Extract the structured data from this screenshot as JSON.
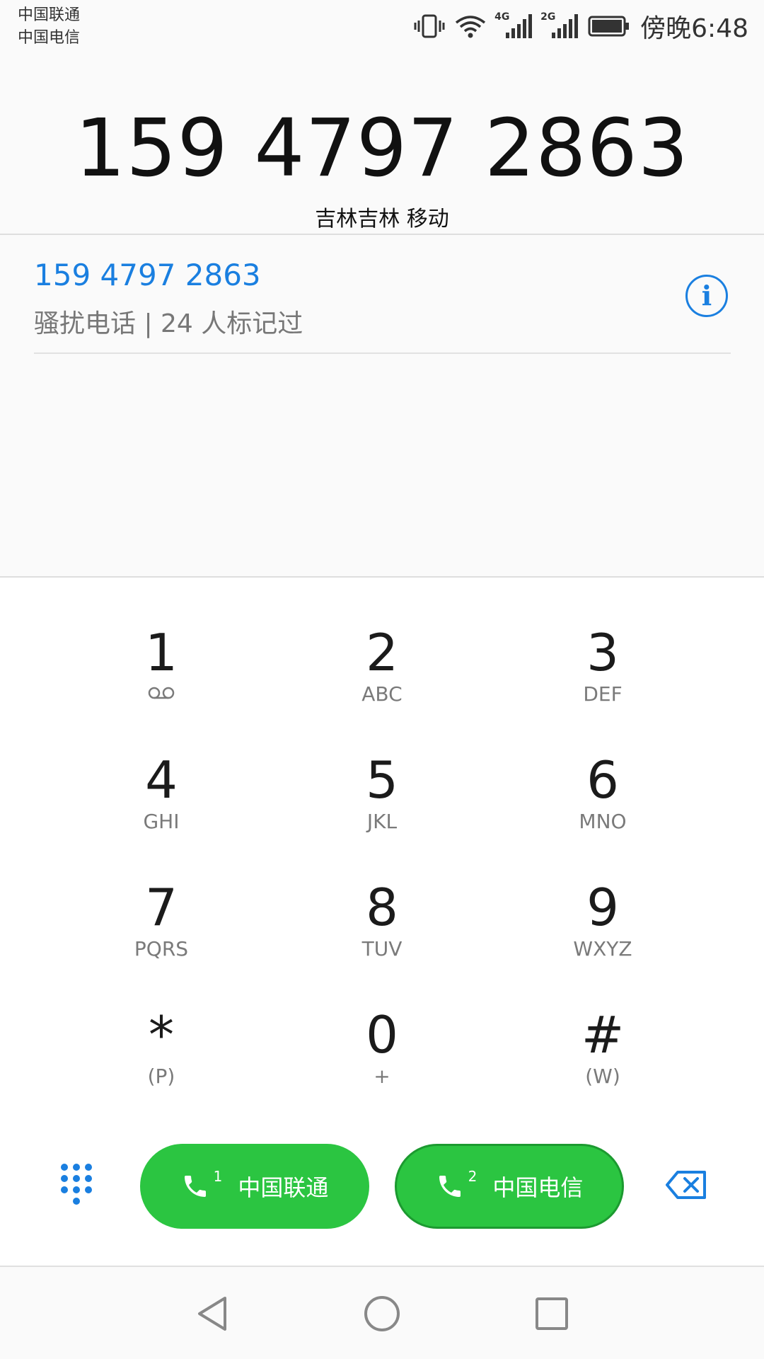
{
  "status_bar": {
    "carrier_1": "中国联通",
    "carrier_2": "中国电信",
    "net_1": "4G",
    "net_2": "2G",
    "time": "傍晚6:48"
  },
  "dialer": {
    "number": "159 4797 2863",
    "location": "吉林吉林 移动"
  },
  "suggestion": {
    "number": "159 4797 2863",
    "tag": "骚扰电话 | 24 人标记过"
  },
  "keypad": [
    {
      "digit": "1",
      "letters": ""
    },
    {
      "digit": "2",
      "letters": "ABC"
    },
    {
      "digit": "3",
      "letters": "DEF"
    },
    {
      "digit": "4",
      "letters": "GHI"
    },
    {
      "digit": "5",
      "letters": "JKL"
    },
    {
      "digit": "6",
      "letters": "MNO"
    },
    {
      "digit": "7",
      "letters": "PQRS"
    },
    {
      "digit": "8",
      "letters": "TUV"
    },
    {
      "digit": "9",
      "letters": "WXYZ"
    },
    {
      "digit": "*",
      "letters": "(P)"
    },
    {
      "digit": "0",
      "letters": "+"
    },
    {
      "digit": "#",
      "letters": "(W)"
    }
  ],
  "actions": {
    "call_sim1_label": "中国联通",
    "call_sim1_slot": "1",
    "call_sim2_label": "中国电信",
    "call_sim2_slot": "2"
  },
  "colors": {
    "accent": "#1a7fe0",
    "call_green": "#2bc541"
  }
}
